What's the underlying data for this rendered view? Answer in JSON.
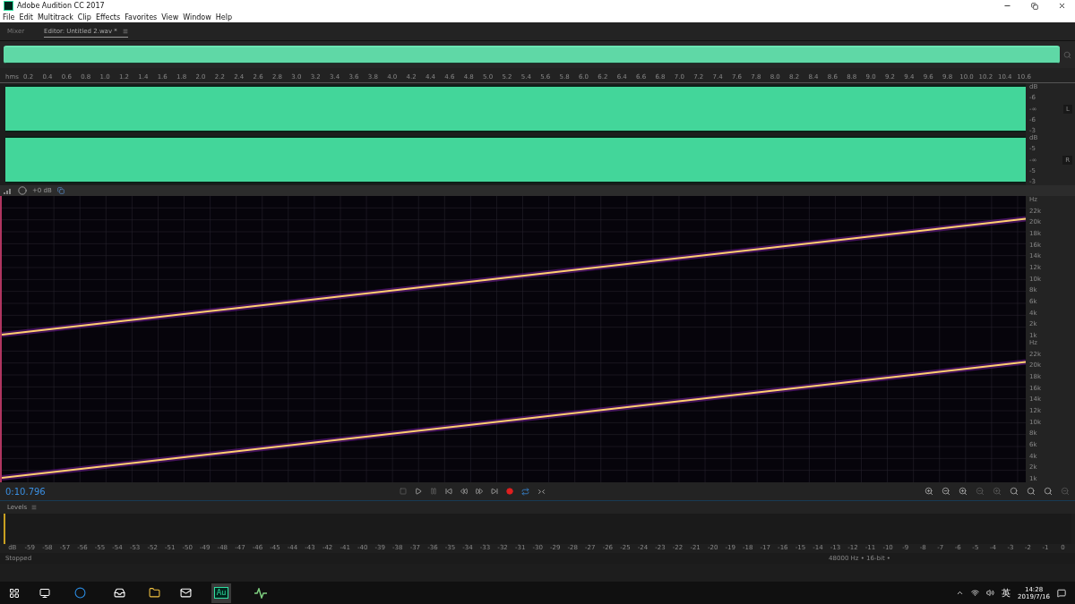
{
  "window": {
    "title": "Adobe Audition CC 2017"
  },
  "menu": [
    "File",
    "Edit",
    "Multitrack",
    "Clip",
    "Effects",
    "Favorites",
    "View",
    "Window",
    "Help"
  ],
  "panel_tabs": [
    {
      "label": "Mixer",
      "selected": false
    },
    {
      "label": "Editor: Untitled 2.wav *",
      "selected": true
    }
  ],
  "ruler": {
    "unit": "hms",
    "ticks": [
      "0.2",
      "0.4",
      "0.6",
      "0.8",
      "1.0",
      "1.2",
      "1.4",
      "1.6",
      "1.8",
      "2.0",
      "2.2",
      "2.4",
      "2.6",
      "2.8",
      "3.0",
      "3.2",
      "3.4",
      "3.6",
      "3.8",
      "4.0",
      "4.2",
      "4.4",
      "4.6",
      "4.8",
      "5.0",
      "5.2",
      "5.4",
      "5.6",
      "5.8",
      "6.0",
      "6.2",
      "6.4",
      "6.6",
      "6.8",
      "7.0",
      "7.2",
      "7.4",
      "7.6",
      "7.8",
      "8.0",
      "8.2",
      "8.4",
      "8.6",
      "8.8",
      "9.0",
      "9.2",
      "9.4",
      "9.6",
      "9.8",
      "10.0",
      "10.2",
      "10.4",
      "10.6"
    ]
  },
  "waveform_channels": [
    {
      "scale": [
        "dB",
        "-6",
        "-∞",
        "-6",
        "-3"
      ],
      "badge": "L"
    },
    {
      "scale": [
        "dB",
        "-5",
        "-∞",
        "-5",
        "-3"
      ],
      "badge": "R"
    }
  ],
  "gain_hud": "+0 dB",
  "spectral_channels": [
    {
      "scale": [
        "Hz",
        "22k",
        "20k",
        "18k",
        "16k",
        "14k",
        "12k",
        "10k",
        "8k",
        "6k",
        "4k",
        "2k",
        "1k"
      ]
    },
    {
      "scale": [
        "Hz",
        "22k",
        "20k",
        "18k",
        "16k",
        "14k",
        "12k",
        "10k",
        "8k",
        "6k",
        "4k",
        "2k",
        "1k"
      ]
    }
  ],
  "time_display": "0:10.796",
  "levels": {
    "title": "Levels",
    "scale": [
      "dB",
      "-59",
      "-58",
      "-57",
      "-56",
      "-55",
      "-54",
      "-53",
      "-52",
      "-51",
      "-50",
      "-49",
      "-48",
      "-47",
      "-46",
      "-45",
      "-44",
      "-43",
      "-42",
      "-41",
      "-40",
      "-39",
      "-38",
      "-37",
      "-36",
      "-35",
      "-34",
      "-33",
      "-32",
      "-31",
      "-30",
      "-29",
      "-28",
      "-27",
      "-26",
      "-25",
      "-24",
      "-23",
      "-22",
      "-21",
      "-20",
      "-19",
      "-18",
      "-17",
      "-16",
      "-15",
      "-14",
      "-13",
      "-12",
      "-11",
      "-10",
      "-9",
      "-8",
      "-7",
      "-6",
      "-5",
      "-4",
      "-3",
      "-2",
      "-1",
      "0"
    ]
  },
  "status_bar": {
    "state": "Stopped",
    "format": "48000 Hz • 16-bit •"
  },
  "taskbar": {
    "app_label": "Au",
    "ime": "英",
    "time": "14:28",
    "date": "2019/7/16"
  }
}
